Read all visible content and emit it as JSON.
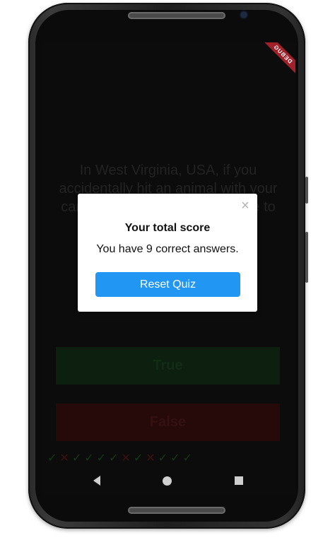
{
  "app": {
    "debug_banner": "DEBUG"
  },
  "quiz": {
    "question": "In West Virginia, USA, if you accidentally hit an animal with your car, you are free to take it home to eat.",
    "true_label": "True",
    "false_label": "False",
    "score_marks": [
      {
        "symbol": "✓",
        "correct": true
      },
      {
        "symbol": "✕",
        "correct": false
      },
      {
        "symbol": "✓",
        "correct": true
      },
      {
        "symbol": "✓",
        "correct": true
      },
      {
        "symbol": "✓",
        "correct": true
      },
      {
        "symbol": "✓",
        "correct": true
      },
      {
        "symbol": "✕",
        "correct": false
      },
      {
        "symbol": "✓",
        "correct": true
      },
      {
        "symbol": "✕",
        "correct": false
      },
      {
        "symbol": "✓",
        "correct": true
      },
      {
        "symbol": "✓",
        "correct": true
      },
      {
        "symbol": "✓",
        "correct": true
      }
    ]
  },
  "dialog": {
    "title": "Your total score",
    "message": "You have 9 correct answers.",
    "button_label": "Reset Quiz",
    "close_icon": "close-icon"
  },
  "colors": {
    "accent": "#2196f3",
    "debug_ribbon": "#a0212a"
  }
}
